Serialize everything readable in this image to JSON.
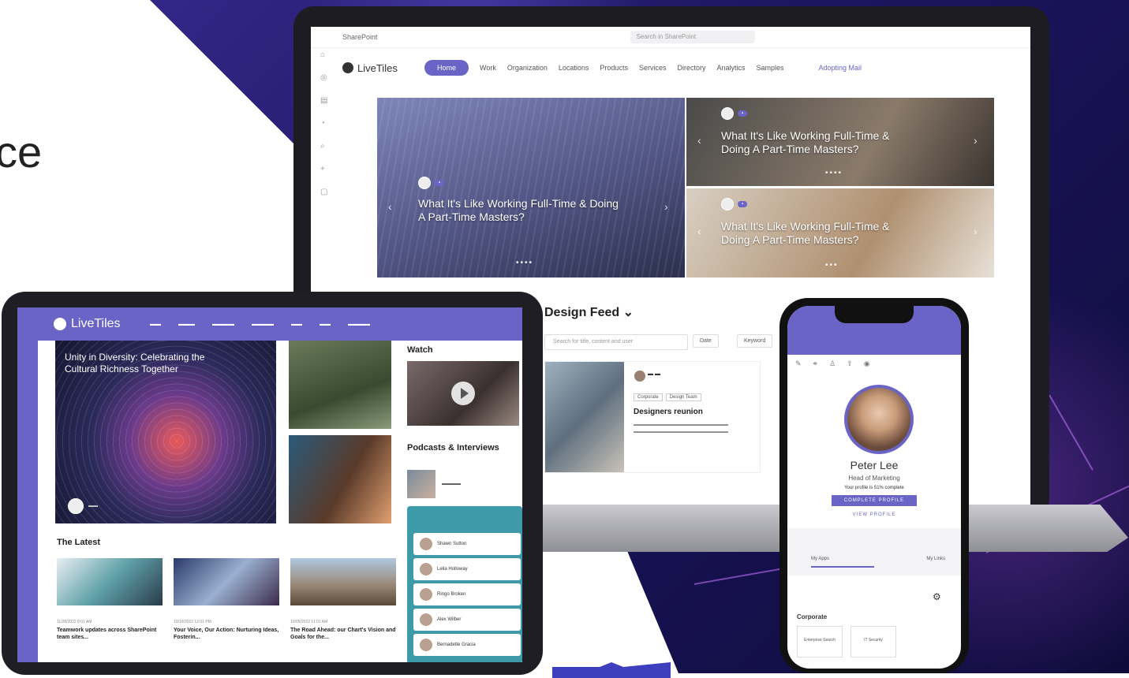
{
  "background": {
    "partial_text": "ce"
  },
  "laptop": {
    "site_label": "SharePoint",
    "search_placeholder": "Search in SharePoint",
    "logo": "LiveTiles",
    "nav": [
      "Home",
      "Work",
      "Organization",
      "Locations",
      "Products",
      "Services",
      "Directory",
      "Analytics",
      "Samples"
    ],
    "nav_right": "Adopting Mail",
    "hero_main_title": "What It's Like Working Full-Time & Doing A Part-Time Masters?",
    "hero_tr_title": "What It's Like Working Full-Time & Doing A Part-Time Masters?",
    "hero_br_title": "What It's Like Working Full-Time & Doing A Part-Time Masters?",
    "feed_title": "Design Feed",
    "feed_search_placeholder": "Search for title, content and user",
    "filter_date": "Date",
    "filter_keyword": "Keyword",
    "feed_chips": [
      "Corporate",
      "Design Team"
    ],
    "feed_card_title": "Designers reunion"
  },
  "tablet": {
    "logo": "LiveTiles",
    "hero_title": "Unity in Diversity: Celebrating the Cultural Richness Together",
    "watch_heading": "Watch",
    "podcasts_heading": "Podcasts & Interviews",
    "latest_heading": "The Latest",
    "latest": [
      {
        "date": "11/28/2022 8:01 AM",
        "title": "Teamwork updates across SharePoint team sites..."
      },
      {
        "date": "10/19/2022 12:01 PM",
        "title": "Your Voice, Our Action: Nurturing Ideas, Fosterin..."
      },
      {
        "date": "10/05/2022 11:01 AM",
        "title": "The Road Ahead: our Chart's Vision and Goals for the..."
      }
    ],
    "team_rows": [
      "Shawn Sutton",
      "Leila Holloway",
      "Ringo Broken",
      "Alex Wilber",
      "Bernadette Gracia"
    ]
  },
  "phone": {
    "name": "Peter Lee",
    "role": "Head of Marketing",
    "completion": "Your profile is 51% complete",
    "complete_button": "COMPLETE PROFILE",
    "view_profile": "VIEW PROFILE",
    "tab_left": "My Apps",
    "tab_right": "My Links",
    "section": "Corporate",
    "tiles": [
      "Enterprise Search",
      "IT Security"
    ]
  }
}
